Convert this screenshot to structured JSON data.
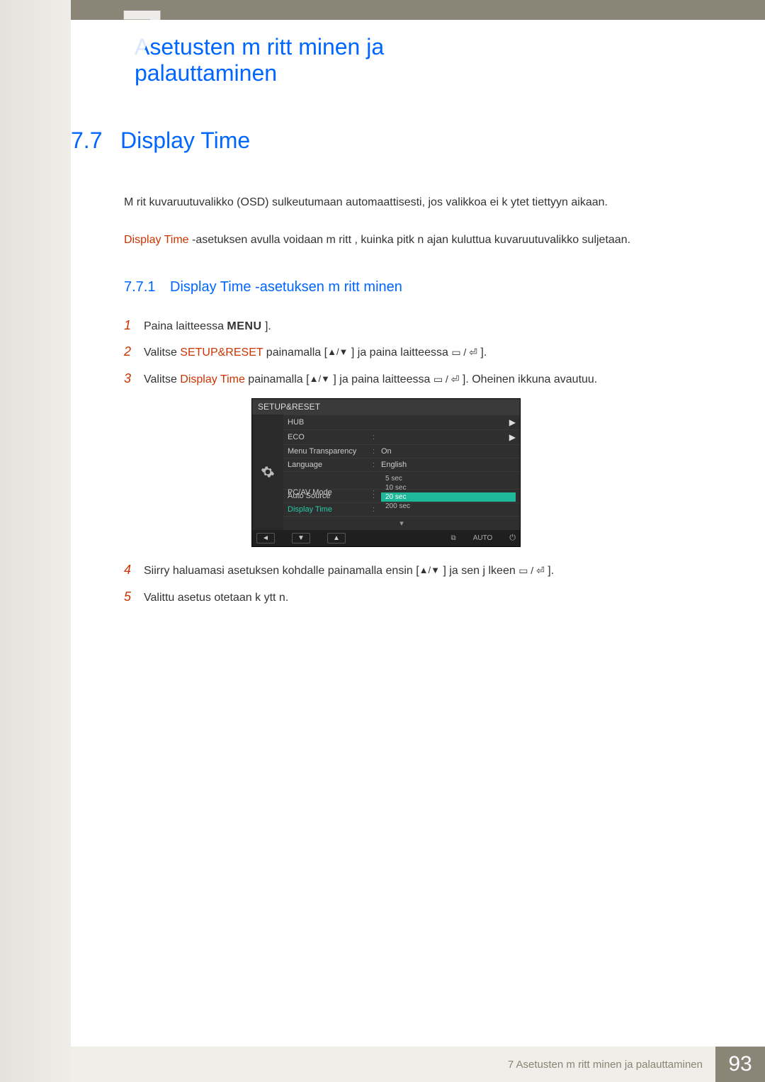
{
  "chapter_number": "7",
  "chapter_title": "Asetusten m  ritt minen ja palauttaminen",
  "section": {
    "num": "7.7",
    "title": "Display Time"
  },
  "para1": "M  rit  kuvaruutuvalikko (OSD) sulkeutumaan automaattisesti, jos valikkoa ei k ytet  tiettyyn aikaan.",
  "para2_red": "Display Time",
  "para2_rest": " -asetuksen avulla voidaan m  ritt  , kuinka pitk n ajan kuluttua kuvaruutuvalikko suljetaan.",
  "subsection": {
    "num": "7.7.1",
    "title": "Display Time -asetuksen m  ritt minen"
  },
  "steps": {
    "s1": {
      "num": "1",
      "pre": "Paina laitteessa ",
      "menu": "MENU",
      "post": " ]."
    },
    "s2": {
      "num": "2",
      "pre": "Valitse ",
      "red": "SETUP&RESET",
      "mid1": " painamalla [",
      "arrows": "▲/▼",
      "mid2": " ] ja paina laitteessa ",
      "icons": "▭ / ⏎",
      "post": " ]."
    },
    "s3": {
      "num": "3",
      "pre": "Valitse ",
      "red": "Display Time",
      "mid1": "  painamalla [",
      "arrows": "▲/▼",
      "mid2": " ] ja paina laitteessa ",
      "icons": "▭ / ⏎",
      "post": " ]. Oheinen ikkuna avautuu."
    },
    "s4": {
      "num": "4",
      "pre": "Siirry haluamasi asetuksen kohdalle painamalla ensin [",
      "arrows": "▲/▼",
      "mid": " ] ja sen j lkeen ",
      "icons": "▭ / ⏎",
      "post": " ]."
    },
    "s5": {
      "num": "5",
      "text": "Valittu asetus otetaan k ytt  n."
    }
  },
  "osd": {
    "title": "SETUP&RESET",
    "items": {
      "hub": "HUB",
      "eco": "ECO",
      "menu_trans_label": "Menu Transparency",
      "menu_trans_value": "On",
      "language_label": "Language",
      "language_value": "English",
      "pcav_label": "PC/AV Mode",
      "autosource_label": "Auto Source",
      "displaytime_label": "Display Time"
    },
    "dropdown": {
      "o1": "5 sec",
      "o2": "10 sec",
      "o3": "20 sec",
      "o4": "200 sec"
    },
    "footer": {
      "back": "◄",
      "down": "▼",
      "up": "▲",
      "auto": "AUTO"
    }
  },
  "footer": {
    "text": "7 Asetusten m  ritt minen ja palauttaminen",
    "page": "93"
  }
}
